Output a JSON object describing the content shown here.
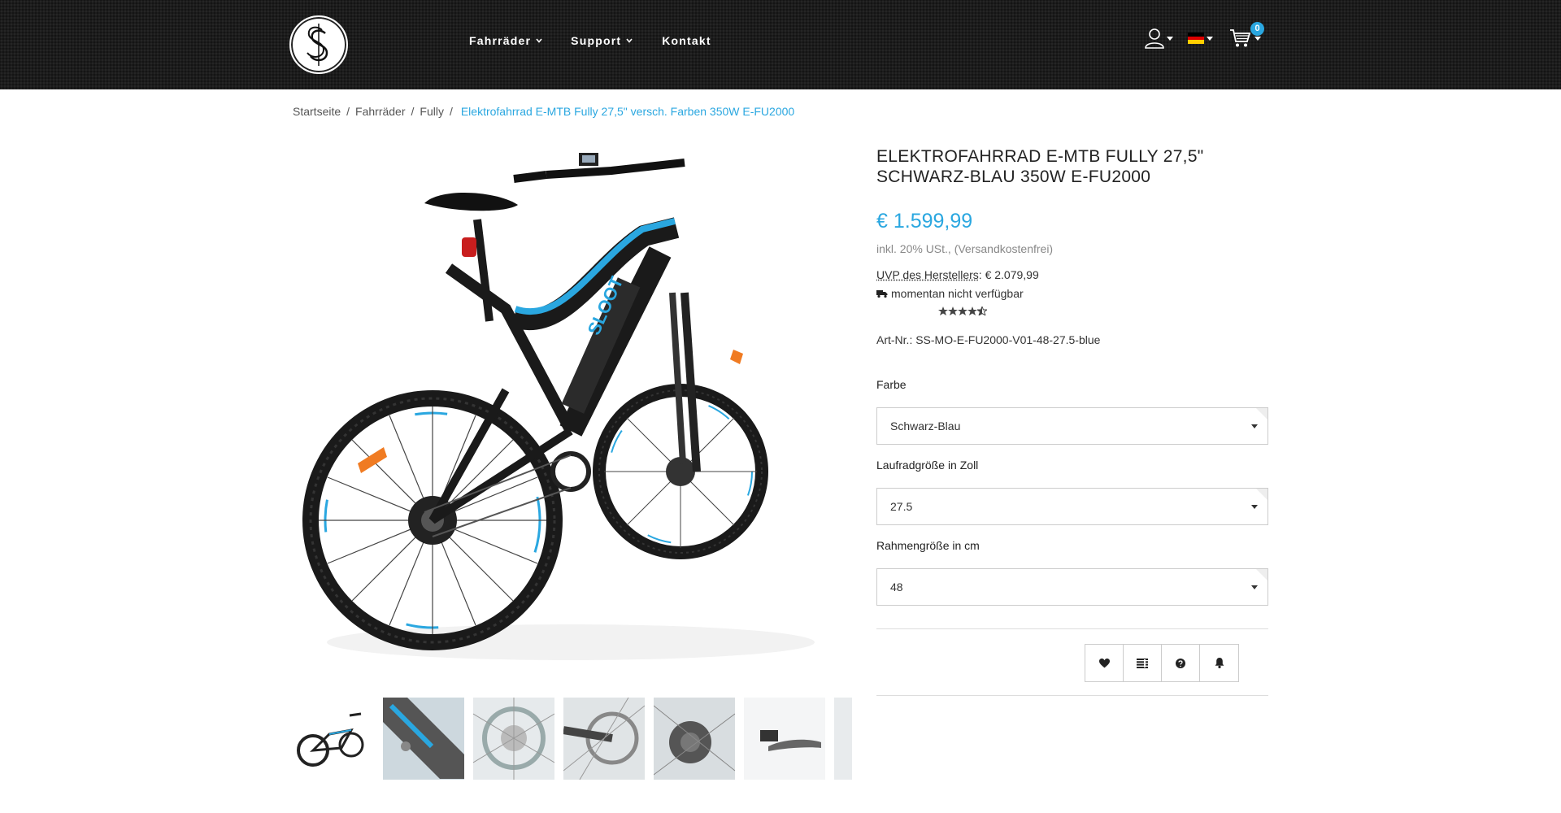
{
  "header": {
    "logo": "SS logo",
    "nav": [
      {
        "label": "Fahrräder",
        "has_dropdown": true
      },
      {
        "label": "Support",
        "has_dropdown": true
      },
      {
        "label": "Kontakt",
        "has_dropdown": false
      }
    ],
    "icons": {
      "account": "user-icon",
      "language": "flag-de-icon",
      "cart": "cart-icon"
    },
    "cart_count": "0"
  },
  "breadcrumb": {
    "items": [
      "Startseite",
      "Fahrräder",
      "Fully"
    ],
    "separator": "/",
    "current": "Elektrofahrrad E-MTB Fully 27,5\" versch. Farben 350W E-FU2000"
  },
  "product": {
    "title": "Elektrofahrrad E-MTB Fully 27,5\" Schwarz-Blau 350W E-FU2000",
    "price": "€ 1.599,99",
    "tax_note": "inkl. 20% USt., (Versandkostenfrei)",
    "uvp_label": "UVP des Herstellers",
    "uvp_value": ": € 2.079,99",
    "availability": "momentan nicht verfügbar",
    "rating": 4.5,
    "art_nr": "Art-Nr.: SS-MO-E-FU2000-V01-48-27.5-blue"
  },
  "options": [
    {
      "label": "Farbe",
      "value": "Schwarz-Blau"
    },
    {
      "label": "Laufradgröße in Zoll",
      "value": "27.5"
    },
    {
      "label": "Rahmengröße in cm",
      "value": "48"
    }
  ],
  "actions": [
    "heart-icon",
    "compare-list-icon",
    "question-icon",
    "bell-icon"
  ],
  "colors": {
    "accent": "#2aa7e0",
    "header_bg": "#1c1c1c",
    "text": "#333333"
  }
}
